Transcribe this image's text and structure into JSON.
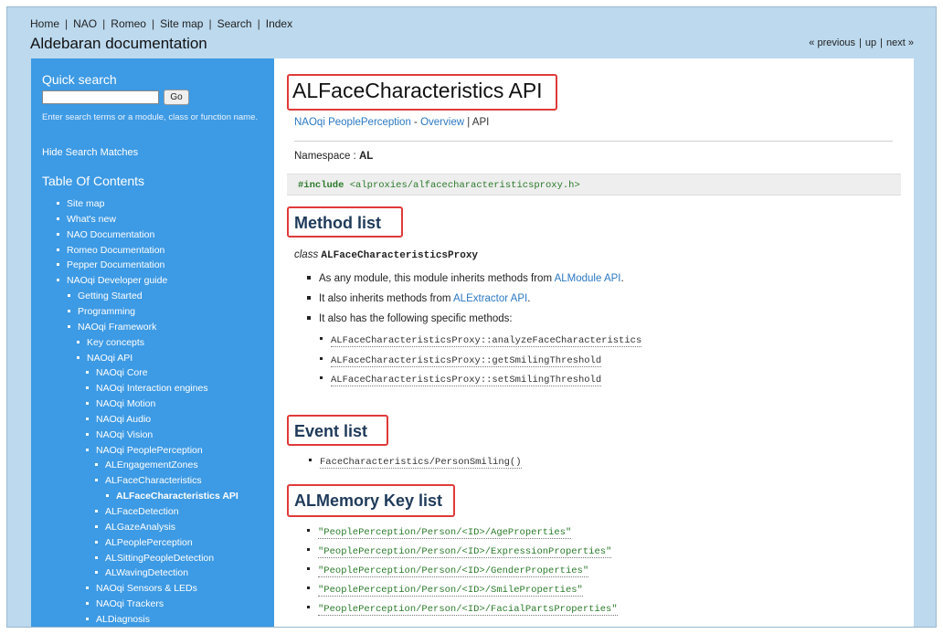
{
  "header": {
    "nav": [
      "Home",
      "NAO",
      "Romeo",
      "Site map",
      "Search",
      "Index"
    ],
    "title": "Aldebaran documentation",
    "relnav": [
      "« previous",
      "up",
      "next »"
    ]
  },
  "sidebar": {
    "quick_search_heading": "Quick search",
    "go_label": "Go",
    "search_value": "",
    "help_text": "Enter search terms or a module, class or function name.",
    "hide_matches": "Hide Search Matches",
    "toc_heading": "Table Of Contents",
    "toc": [
      {
        "label": "Site map",
        "level": 1
      },
      {
        "label": "What's new",
        "level": 1
      },
      {
        "label": "NAO Documentation",
        "level": 1
      },
      {
        "label": "Romeo Documentation",
        "level": 1
      },
      {
        "label": "Pepper Documentation",
        "level": 1
      },
      {
        "label": "NAOqi Developer guide",
        "level": 1
      },
      {
        "label": "Getting Started",
        "level": 2
      },
      {
        "label": "Programming",
        "level": 2
      },
      {
        "label": "NAOqi Framework",
        "level": 2
      },
      {
        "label": "Key concepts",
        "level": 3
      },
      {
        "label": "NAOqi API",
        "level": 3
      },
      {
        "label": "NAOqi Core",
        "level": 4
      },
      {
        "label": "NAOqi Interaction engines",
        "level": 4
      },
      {
        "label": "NAOqi Motion",
        "level": 4
      },
      {
        "label": "NAOqi Audio",
        "level": 4
      },
      {
        "label": "NAOqi Vision",
        "level": 4
      },
      {
        "label": "NAOqi PeoplePerception",
        "level": 4
      },
      {
        "label": "ALEngagementZones",
        "level": 5
      },
      {
        "label": "ALFaceCharacteristics",
        "level": 5
      },
      {
        "label": "ALFaceCharacteristics API",
        "level": 6,
        "current": true
      },
      {
        "label": "ALFaceDetection",
        "level": 5
      },
      {
        "label": "ALGazeAnalysis",
        "level": 5
      },
      {
        "label": "ALPeoplePerception",
        "level": 5
      },
      {
        "label": "ALSittingPeopleDetection",
        "level": 5
      },
      {
        "label": "ALWavingDetection",
        "level": 5
      },
      {
        "label": "NAOqi Sensors & LEDs",
        "level": 4
      },
      {
        "label": "NAOqi Trackers",
        "level": 4
      },
      {
        "label": "ALDiagnosis",
        "level": 4
      }
    ]
  },
  "main": {
    "title": "ALFaceCharacteristics API",
    "breadcrumb": {
      "parent": "NAOqi PeoplePerception",
      "dash": " - ",
      "overview": "Overview",
      "sep": " | ",
      "current": "API"
    },
    "namespace_label": "Namespace : ",
    "namespace_value": "AL",
    "include_kw": "#include",
    "include_path": "<alproxies/alfacecharacteristicsproxy.h>",
    "method_list_heading": "Method list",
    "class_kw": "class",
    "class_name": "ALFaceCharacteristicsProxy",
    "method_items": [
      {
        "text": "As any module, this module inherits methods from ",
        "link": "ALModule API",
        "suffix": "."
      },
      {
        "text": "It also inherits methods from ",
        "link": "ALExtractor API",
        "suffix": "."
      },
      {
        "text": "It also has the following specific methods:",
        "link": "",
        "suffix": ""
      }
    ],
    "specific_methods": [
      "ALFaceCharacteristicsProxy::analyzeFaceCharacteristics",
      "ALFaceCharacteristicsProxy::getSmilingThreshold",
      "ALFaceCharacteristicsProxy::setSmilingThreshold"
    ],
    "event_list_heading": "Event list",
    "events": [
      "FaceCharacteristics/PersonSmiling()"
    ],
    "memory_heading": "ALMemory Key list",
    "memory_keys": [
      "\"PeoplePerception/Person/<ID>/AgeProperties\"",
      "\"PeoplePerception/Person/<ID>/ExpressionProperties\"",
      "\"PeoplePerception/Person/<ID>/GenderProperties\"",
      "\"PeoplePerception/Person/<ID>/SmileProperties\"",
      "\"PeoplePerception/Person/<ID>/FacialPartsProperties\""
    ]
  }
}
